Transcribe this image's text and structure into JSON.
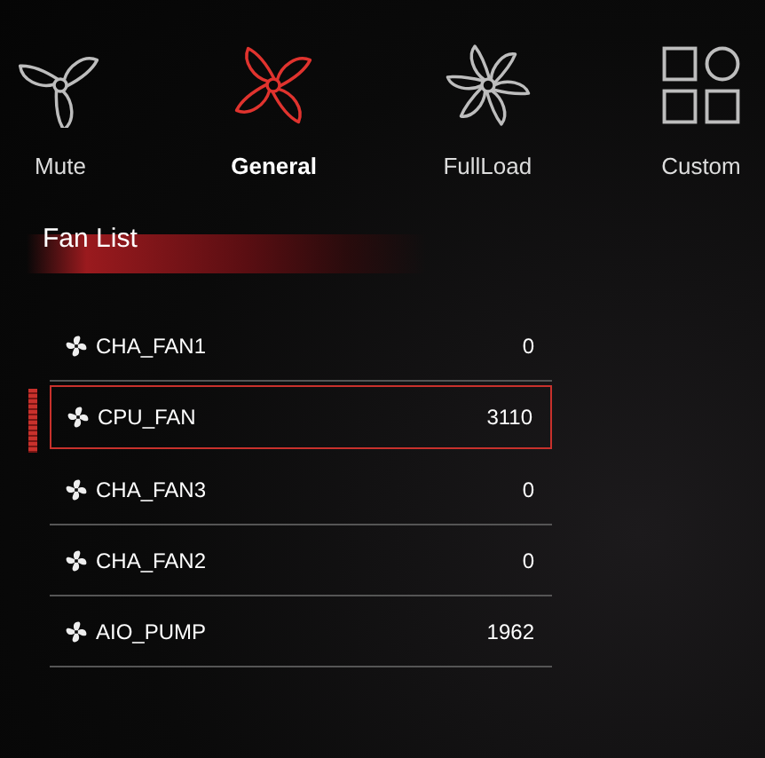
{
  "modes": [
    {
      "label": "Mute",
      "kind": "fan3",
      "selected": false
    },
    {
      "label": "General",
      "kind": "fan4",
      "selected": true
    },
    {
      "label": "FullLoad",
      "kind": "fan6",
      "selected": false
    },
    {
      "label": "Custom",
      "kind": "grid",
      "selected": false
    }
  ],
  "fan_list": {
    "title": "Fan List",
    "fans": [
      {
        "name": "CHA_FAN1",
        "speed": "0",
        "selected": false
      },
      {
        "name": "CPU_FAN",
        "speed": "3110",
        "selected": true
      },
      {
        "name": "CHA_FAN3",
        "speed": "0",
        "selected": false
      },
      {
        "name": "CHA_FAN2",
        "speed": "0",
        "selected": false
      },
      {
        "name": "AIO_PUMP",
        "speed": "1962",
        "selected": false
      }
    ]
  }
}
